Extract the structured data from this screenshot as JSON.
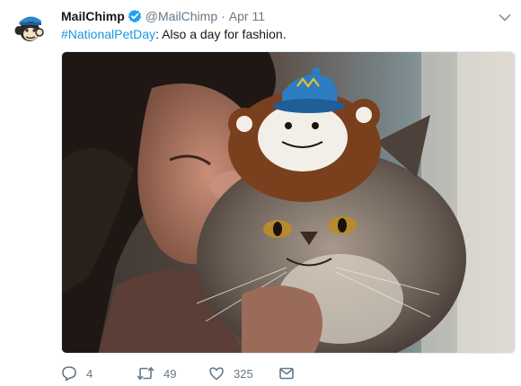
{
  "tweet": {
    "author_name": "MailChimp",
    "handle": "@MailChimp",
    "separator": "·",
    "date": "Apr 11",
    "hashtag": "#NationalPetDay",
    "text_rest": ": Also a day for fashion."
  },
  "actions": {
    "replies": "4",
    "retweets": "49",
    "likes": "325"
  },
  "icons": {
    "avatar": "mailchimp-freddie-logo",
    "verified": "verified-badge-icon",
    "caret": "chevron-down-icon",
    "reply": "reply-bubble-icon",
    "retweet": "retweet-icon",
    "like": "heart-icon",
    "dm": "envelope-icon"
  },
  "colors": {
    "link_blue": "#1b95e0",
    "muted_gray": "#657786",
    "text_dark": "#14171a"
  }
}
